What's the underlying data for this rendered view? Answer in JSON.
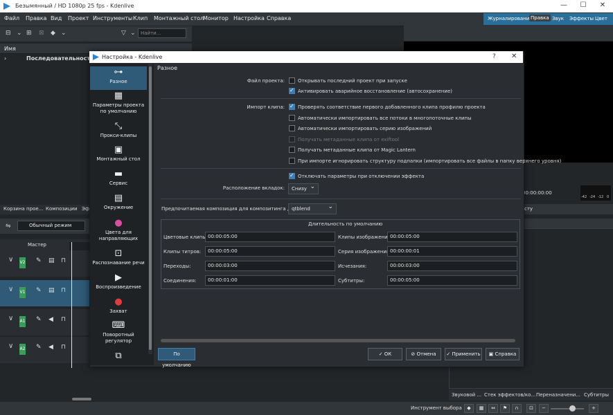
{
  "window": {
    "title": "Безымянный / HD 1080p 25 fps - Kdenlive",
    "minimize": "—",
    "maximize": "☐",
    "close": "✕"
  },
  "menu": [
    "Файл",
    "Правка",
    "Вид",
    "Проект",
    "Инструменты",
    "Клип",
    "Монтажный стол",
    "Монитор",
    "Настройка",
    "Справка"
  ],
  "workspaces": [
    "Журналирование",
    "Правка",
    "Звук",
    "Эффекты",
    "Цвет"
  ],
  "bin": {
    "search_placeholder": "Найти...",
    "header": "Имя",
    "folder": "Последовательности"
  },
  "left_tabs": [
    "Корзина прое...",
    "Композиции",
    "Эф"
  ],
  "timeline": {
    "mode": "Обычный режим",
    "master": "Мастер",
    "tracks": [
      "V2",
      "V1",
      "A1",
      "A2"
    ]
  },
  "monitor": {
    "timecode": "00:00:00:00",
    "meter_labels": [
      "-42",
      "-24",
      "-12",
      "0"
    ],
    "stack_tab": "сту"
  },
  "bottom_tabs": [
    "Звуковой ...",
    "Стек эффектов/ко...",
    "Переназначени...",
    "Субтитры"
  ],
  "status": {
    "tool": "Инструмент выбора"
  },
  "dialog": {
    "title": "Настройка - Kdenlive",
    "help_glyph": "?",
    "close_glyph": "✕",
    "sidebar": [
      {
        "label": "Разное",
        "icon": "⊶"
      },
      {
        "label": "Параметры проекта по умолчанию",
        "icon": "▦"
      },
      {
        "label": "Прокси-клипы",
        "icon": "⤡"
      },
      {
        "label": "Монтажный стол",
        "icon": "▣"
      },
      {
        "label": "Сервис",
        "icon": "▬"
      },
      {
        "label": "Окружение",
        "icon": "▤"
      },
      {
        "label": "Цвета для направляющих",
        "icon": "●"
      },
      {
        "label": "Распознавание речи",
        "icon": "⊡"
      },
      {
        "label": "Воспроизведение",
        "icon": "▶"
      },
      {
        "label": "Захват",
        "icon": "●"
      },
      {
        "label": "Поворотный регулятор",
        "icon": "⌨"
      },
      {
        "label": "",
        "icon": "⧉"
      }
    ],
    "page_title": "Разное",
    "project_file_label": "Файл проекта:",
    "open_last": "Открывать последний проект при запуске",
    "autosave": "Активировать аварийное восстановление (автосохранение)",
    "import_label": "Импорт клипа:",
    "check_profile": "Проверять соответствие первого добавленного клипа профилю проекта",
    "import_streams": "Автоматически импортировать все потоки в многопоточные клипы",
    "import_sequence": "Автоматически импортировать серию изображений",
    "exiftool": "Получать метаданные клипа от exiftool",
    "magic_lantern": "Получать метаданные клипа от Magic Lantern",
    "ignore_subfolders": "При импорте игнорировать структуру подпапки (импортировать все файлы в папку верхнего уровня)",
    "disable_params": "Отключать параметры при отключении эффекта",
    "tab_position_label": "Расположение вкладок:",
    "tab_position_value": "Снизу",
    "compositing_label": "Предпочитаемая композиция для композитинга дорожек:",
    "compositing_value": "qtblend",
    "durations_title": "Длительность по умолчанию",
    "durations": {
      "color_clips": {
        "label": "Цветовые клипы:",
        "value": "00:00:05:00"
      },
      "image_clips": {
        "label": "Клипы изображений:",
        "value": "00:00:05:00"
      },
      "title_clips": {
        "label": "Клипы титров:",
        "value": "00:00:05:00"
      },
      "image_sequence": {
        "label": "Серия изображений:",
        "value": "00:00:00:01"
      },
      "transitions": {
        "label": "Переходы:",
        "value": "00:00:03:00"
      },
      "fades": {
        "label": "Исчезания:",
        "value": "00:00:03:00"
      },
      "mixes": {
        "label": "Соединения:",
        "value": "00:00:01:00"
      },
      "subtitles": {
        "label": "Субтитры:",
        "value": "00:00:05:00"
      }
    },
    "buttons": {
      "defaults": "По умолчанию",
      "ok": "✓  ОК",
      "cancel": "⊘  Отмена",
      "apply": "✓  Применить",
      "help": "▣  Справка"
    }
  }
}
